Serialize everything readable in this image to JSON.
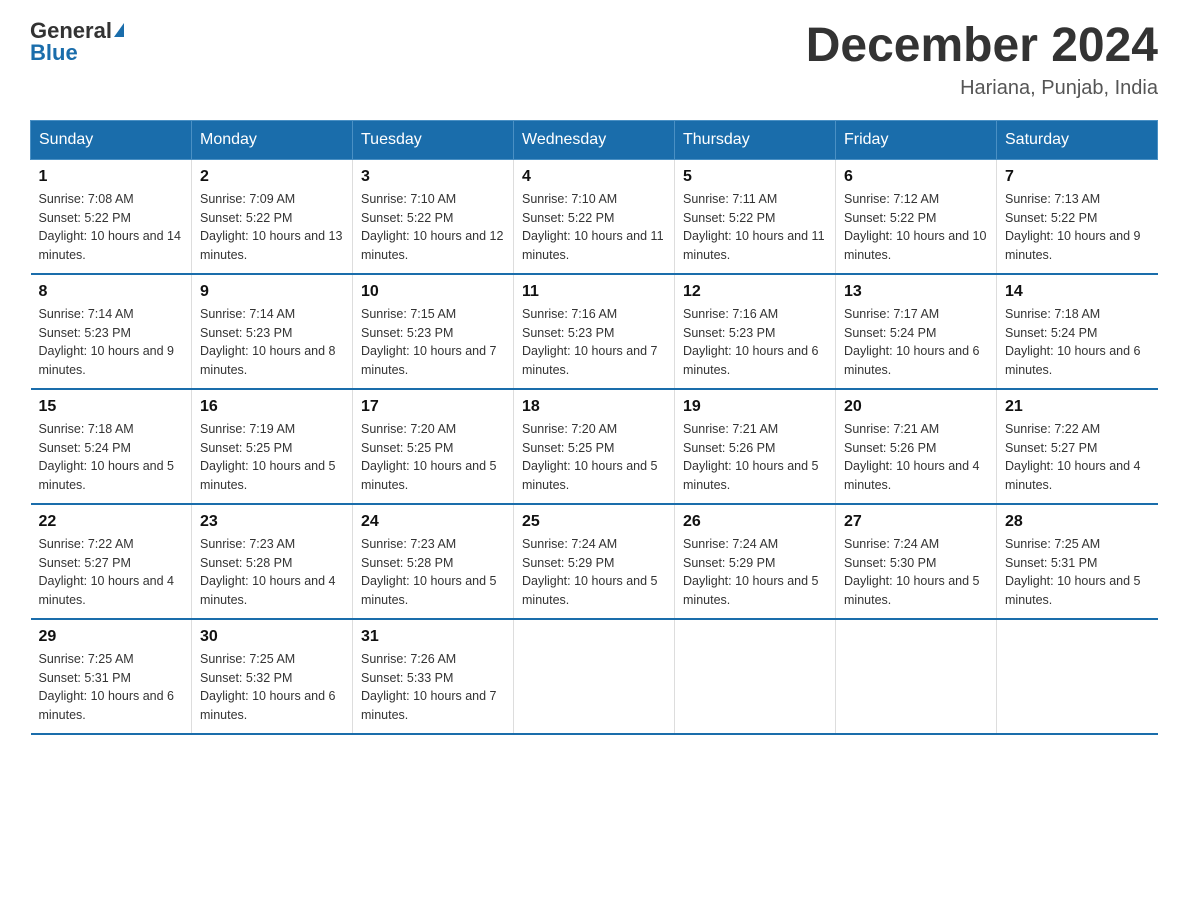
{
  "header": {
    "logo_general": "General",
    "logo_blue": "Blue",
    "title": "December 2024",
    "subtitle": "Hariana, Punjab, India"
  },
  "days_of_week": [
    "Sunday",
    "Monday",
    "Tuesday",
    "Wednesday",
    "Thursday",
    "Friday",
    "Saturday"
  ],
  "weeks": [
    [
      {
        "num": "1",
        "sunrise": "7:08 AM",
        "sunset": "5:22 PM",
        "daylight": "10 hours and 14 minutes."
      },
      {
        "num": "2",
        "sunrise": "7:09 AM",
        "sunset": "5:22 PM",
        "daylight": "10 hours and 13 minutes."
      },
      {
        "num": "3",
        "sunrise": "7:10 AM",
        "sunset": "5:22 PM",
        "daylight": "10 hours and 12 minutes."
      },
      {
        "num": "4",
        "sunrise": "7:10 AM",
        "sunset": "5:22 PM",
        "daylight": "10 hours and 11 minutes."
      },
      {
        "num": "5",
        "sunrise": "7:11 AM",
        "sunset": "5:22 PM",
        "daylight": "10 hours and 11 minutes."
      },
      {
        "num": "6",
        "sunrise": "7:12 AM",
        "sunset": "5:22 PM",
        "daylight": "10 hours and 10 minutes."
      },
      {
        "num": "7",
        "sunrise": "7:13 AM",
        "sunset": "5:22 PM",
        "daylight": "10 hours and 9 minutes."
      }
    ],
    [
      {
        "num": "8",
        "sunrise": "7:14 AM",
        "sunset": "5:23 PM",
        "daylight": "10 hours and 9 minutes."
      },
      {
        "num": "9",
        "sunrise": "7:14 AM",
        "sunset": "5:23 PM",
        "daylight": "10 hours and 8 minutes."
      },
      {
        "num": "10",
        "sunrise": "7:15 AM",
        "sunset": "5:23 PM",
        "daylight": "10 hours and 7 minutes."
      },
      {
        "num": "11",
        "sunrise": "7:16 AM",
        "sunset": "5:23 PM",
        "daylight": "10 hours and 7 minutes."
      },
      {
        "num": "12",
        "sunrise": "7:16 AM",
        "sunset": "5:23 PM",
        "daylight": "10 hours and 6 minutes."
      },
      {
        "num": "13",
        "sunrise": "7:17 AM",
        "sunset": "5:24 PM",
        "daylight": "10 hours and 6 minutes."
      },
      {
        "num": "14",
        "sunrise": "7:18 AM",
        "sunset": "5:24 PM",
        "daylight": "10 hours and 6 minutes."
      }
    ],
    [
      {
        "num": "15",
        "sunrise": "7:18 AM",
        "sunset": "5:24 PM",
        "daylight": "10 hours and 5 minutes."
      },
      {
        "num": "16",
        "sunrise": "7:19 AM",
        "sunset": "5:25 PM",
        "daylight": "10 hours and 5 minutes."
      },
      {
        "num": "17",
        "sunrise": "7:20 AM",
        "sunset": "5:25 PM",
        "daylight": "10 hours and 5 minutes."
      },
      {
        "num": "18",
        "sunrise": "7:20 AM",
        "sunset": "5:25 PM",
        "daylight": "10 hours and 5 minutes."
      },
      {
        "num": "19",
        "sunrise": "7:21 AM",
        "sunset": "5:26 PM",
        "daylight": "10 hours and 5 minutes."
      },
      {
        "num": "20",
        "sunrise": "7:21 AM",
        "sunset": "5:26 PM",
        "daylight": "10 hours and 4 minutes."
      },
      {
        "num": "21",
        "sunrise": "7:22 AM",
        "sunset": "5:27 PM",
        "daylight": "10 hours and 4 minutes."
      }
    ],
    [
      {
        "num": "22",
        "sunrise": "7:22 AM",
        "sunset": "5:27 PM",
        "daylight": "10 hours and 4 minutes."
      },
      {
        "num": "23",
        "sunrise": "7:23 AM",
        "sunset": "5:28 PM",
        "daylight": "10 hours and 4 minutes."
      },
      {
        "num": "24",
        "sunrise": "7:23 AM",
        "sunset": "5:28 PM",
        "daylight": "10 hours and 5 minutes."
      },
      {
        "num": "25",
        "sunrise": "7:24 AM",
        "sunset": "5:29 PM",
        "daylight": "10 hours and 5 minutes."
      },
      {
        "num": "26",
        "sunrise": "7:24 AM",
        "sunset": "5:29 PM",
        "daylight": "10 hours and 5 minutes."
      },
      {
        "num": "27",
        "sunrise": "7:24 AM",
        "sunset": "5:30 PM",
        "daylight": "10 hours and 5 minutes."
      },
      {
        "num": "28",
        "sunrise": "7:25 AM",
        "sunset": "5:31 PM",
        "daylight": "10 hours and 5 minutes."
      }
    ],
    [
      {
        "num": "29",
        "sunrise": "7:25 AM",
        "sunset": "5:31 PM",
        "daylight": "10 hours and 6 minutes."
      },
      {
        "num": "30",
        "sunrise": "7:25 AM",
        "sunset": "5:32 PM",
        "daylight": "10 hours and 6 minutes."
      },
      {
        "num": "31",
        "sunrise": "7:26 AM",
        "sunset": "5:33 PM",
        "daylight": "10 hours and 7 minutes."
      },
      null,
      null,
      null,
      null
    ]
  ],
  "labels": {
    "sunrise": "Sunrise:",
    "sunset": "Sunset:",
    "daylight": "Daylight:"
  }
}
